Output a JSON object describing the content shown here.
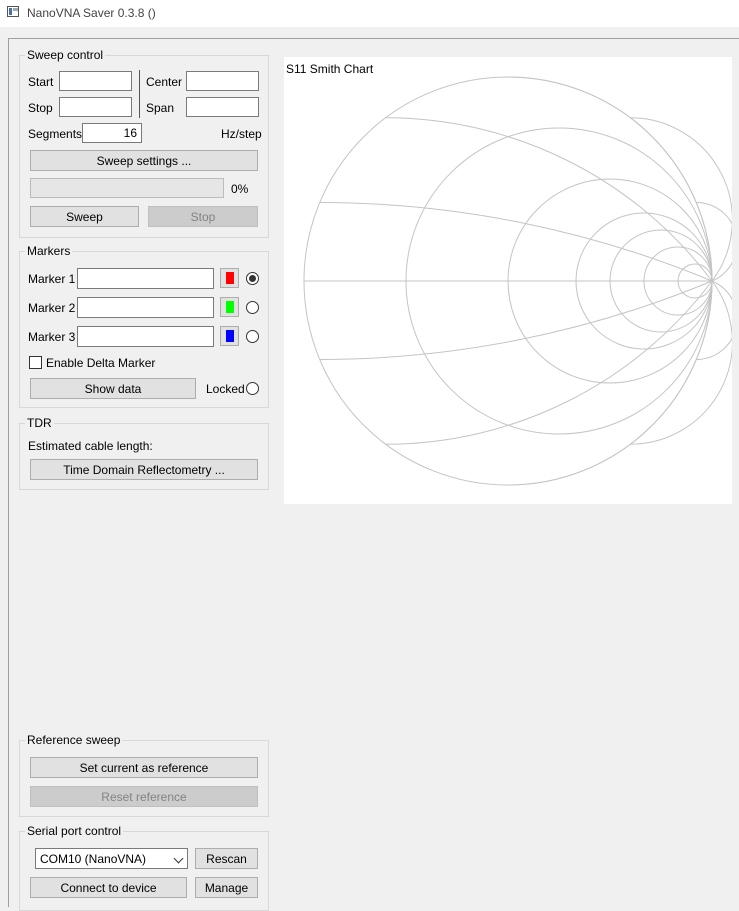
{
  "window": {
    "title": "NanoVNA Saver 0.3.8 ()"
  },
  "sweep_control": {
    "title": "Sweep control",
    "start_label": "Start",
    "start_value": "",
    "center_label": "Center",
    "center_value": "",
    "stop_label": "Stop",
    "stop_value": "",
    "span_label": "Span",
    "span_value": "",
    "segments_label": "Segments",
    "segments_value": "16",
    "hz_step_label": "Hz/step",
    "sweep_settings_label": "Sweep settings ...",
    "progress_text": "0%",
    "progress_fraction": 0,
    "sweep_label": "Sweep",
    "stop_button_label": "Stop"
  },
  "markers": {
    "title": "Markers",
    "items": [
      {
        "label": "Marker 1",
        "value": "",
        "color": "#ff0000",
        "selected": true
      },
      {
        "label": "Marker 2",
        "value": "",
        "color": "#00ff00",
        "selected": false
      },
      {
        "label": "Marker 3",
        "value": "",
        "color": "#0000ff",
        "selected": false
      }
    ],
    "enable_delta_label": "Enable Delta Marker",
    "enable_delta_checked": false,
    "show_data_label": "Show data",
    "locked_label": "Locked",
    "locked_checked": false
  },
  "tdr": {
    "title": "TDR",
    "estimated_label": "Estimated cable length:",
    "button_label": "Time Domain Reflectometry ..."
  },
  "chart": {
    "title": "S11 Smith Chart",
    "grid_color": "#c4c4c4"
  },
  "reference_sweep": {
    "title": "Reference sweep",
    "set_label": "Set current as reference",
    "reset_label": "Reset reference"
  },
  "serial_port": {
    "title": "Serial port control",
    "selected_port": "COM10 (NanoVNA)",
    "rescan_label": "Rescan",
    "connect_label": "Connect to device",
    "manage_label": "Manage"
  }
}
